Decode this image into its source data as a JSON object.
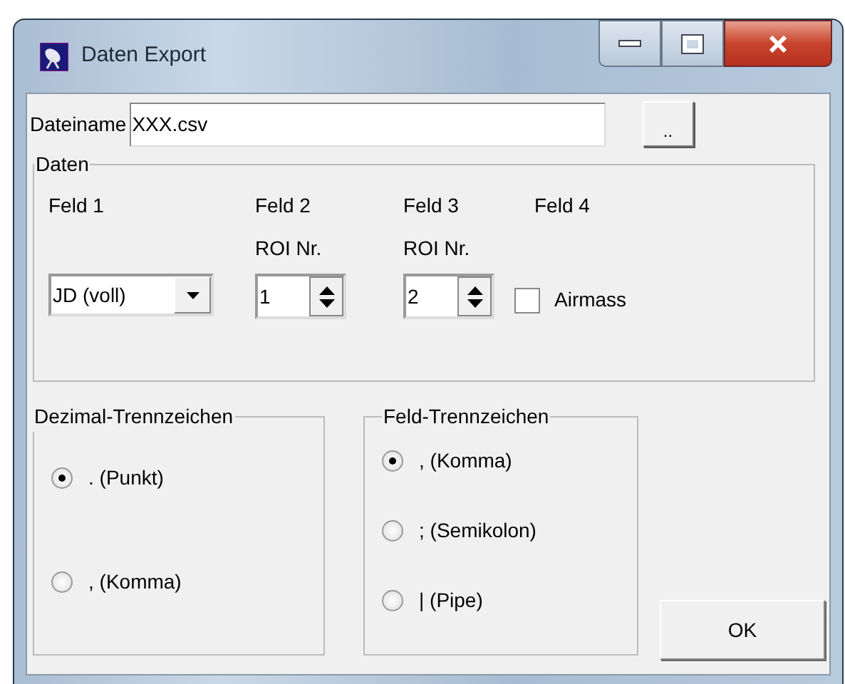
{
  "window": {
    "title": "Daten Export"
  },
  "filename": {
    "label": "Dateiname",
    "value": "XXX.csv",
    "browse_button": ".."
  },
  "daten": {
    "title": "Daten",
    "fields": [
      {
        "label": "Feld 1",
        "kind": "dropdown",
        "value": "JD (voll)"
      },
      {
        "label": "Feld 2",
        "sublabel": "ROI Nr.",
        "kind": "spinner",
        "value": "1"
      },
      {
        "label": "Feld 3",
        "sublabel": "ROI Nr.",
        "kind": "spinner",
        "value": "2"
      },
      {
        "label": "Feld 4",
        "kind": "checkbox",
        "text": "Airmass",
        "checked": false
      }
    ]
  },
  "decimal_separator": {
    "title": "Dezimal-Trennzeichen",
    "options": [
      {
        "label": ". (Punkt)",
        "selected": true
      },
      {
        "label": ", (Komma)",
        "selected": false
      }
    ]
  },
  "field_separator": {
    "title": "Feld-Trennzeichen",
    "options": [
      {
        "label": ", (Komma)",
        "selected": true
      },
      {
        "label": "; (Semikolon)",
        "selected": false
      },
      {
        "label": "| (Pipe)",
        "selected": false
      }
    ]
  },
  "ok_button": "OK"
}
